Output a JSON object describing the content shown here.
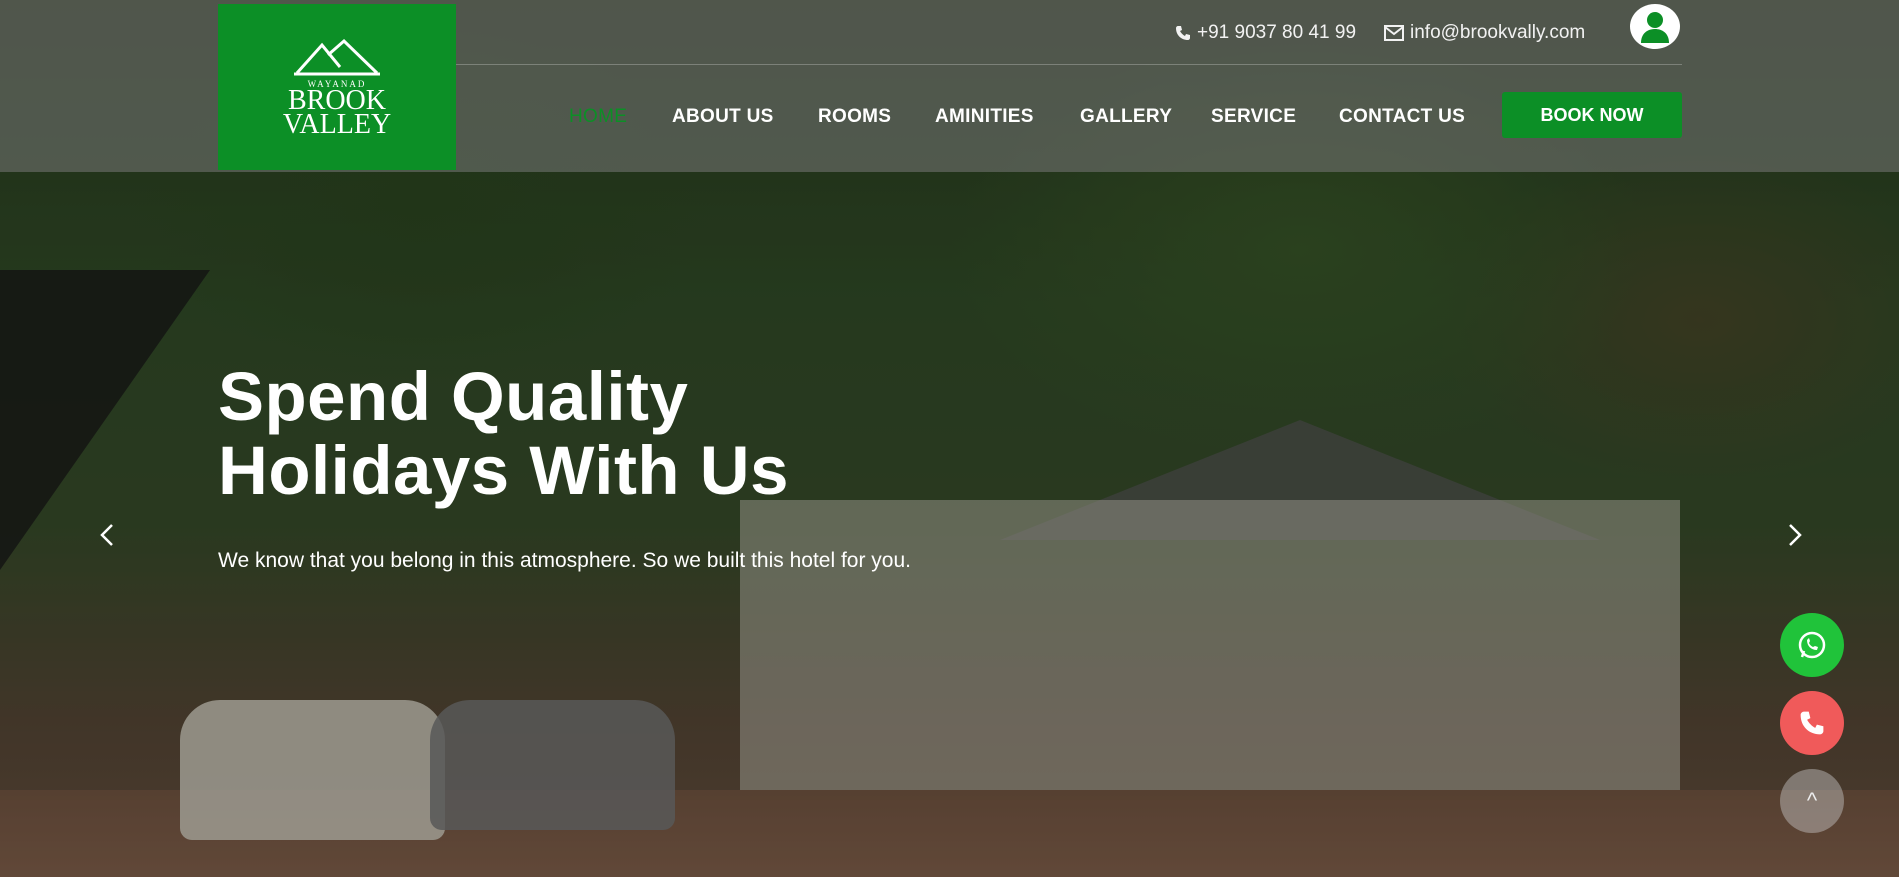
{
  "colors": {
    "brand_green": "#0c8f26",
    "whatsapp_green": "#20c33a",
    "call_red": "#f05a5a"
  },
  "logo": {
    "top_text": "WAYANAD",
    "line1": "BROOK",
    "line2": "VALLEY"
  },
  "contact": {
    "phone": "+91 9037 80 41 99",
    "email": "info@brookvally.com"
  },
  "nav": {
    "items": [
      {
        "label": "HOME",
        "active": true
      },
      {
        "label": "ABOUT US"
      },
      {
        "label": "ROOMS"
      },
      {
        "label": "AMINITIES"
      },
      {
        "label": "GALLERY"
      },
      {
        "label": "SERVICE"
      },
      {
        "label": "CONTACT US"
      }
    ],
    "book_now": "BOOK NOW"
  },
  "hero": {
    "headline_line1": "Spend Quality",
    "headline_line2": "Holidays With Us",
    "subtext": "We know that you belong in this atmosphere. So we built this hotel for you."
  },
  "floating": {
    "scroll_top_symbol": "^"
  },
  "icons": [
    "phone-icon",
    "envelope-icon",
    "user-icon",
    "chevron-left-icon",
    "chevron-right-icon",
    "whatsapp-icon",
    "phone-call-icon",
    "arrow-up-icon"
  ]
}
